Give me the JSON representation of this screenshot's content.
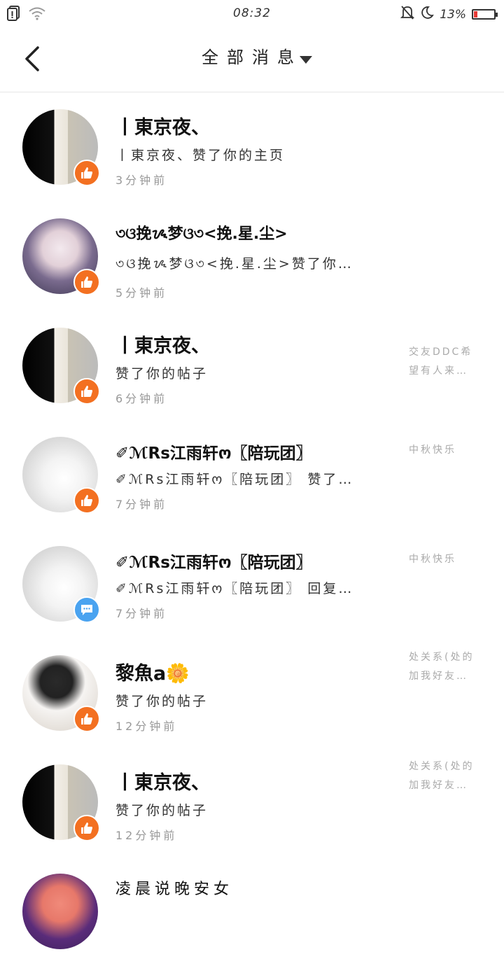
{
  "status_bar": {
    "time": "08:32",
    "battery": "13%",
    "battery_level": 0.13,
    "icons": [
      "notification-icon",
      "wifi-icon",
      "mute-bell-icon",
      "moon-icon",
      "battery-icon"
    ]
  },
  "header": {
    "title": "全部消息",
    "colors": {
      "divider": "#e6e6e6"
    }
  },
  "colors": {
    "like_badge": "#f37021",
    "comment_badge": "#4aa3f0"
  },
  "messages": [
    {
      "name": "丨東京夜、",
      "action": "丨東京夜、赞了你的主页",
      "time": "3分钟前",
      "badge": "like-icon",
      "preview": ""
    },
    {
      "name": "৩ଓ挽ᝰ梦ଓ৩<挽.星.尘>",
      "action": "৩ଓ挽ᝰ梦ଓ৩<挽.星.尘>赞了你…",
      "time": "5分钟前",
      "badge": "like-icon",
      "preview": ""
    },
    {
      "name": "丨東京夜、",
      "action": "赞了你的帖子",
      "time": "6分钟前",
      "badge": "like-icon",
      "preview": "交友DDC希望有人来…"
    },
    {
      "name": "✐ℳRs江雨轩ო〖陪玩团〗",
      "action": "✐ℳRs江雨轩ო〖陪玩团〗 赞了…",
      "time": "7分钟前",
      "badge": "like-icon",
      "preview": "中秋快乐"
    },
    {
      "name": "✐ℳRs江雨轩ო〖陪玩团〗",
      "action": "✐ℳRs江雨轩ო〖陪玩团〗 回复…",
      "time": "7分钟前",
      "badge": "comment-icon",
      "preview": "中秋快乐"
    },
    {
      "name": "黎魚a🌼",
      "action": "赞了你的帖子",
      "time": "12分钟前",
      "badge": "like-icon",
      "preview": "处关系(处的加我好友…"
    },
    {
      "name": "丨東京夜、",
      "action": "赞了你的帖子",
      "time": "12分钟前",
      "badge": "like-icon",
      "preview": "处关系(处的加我好友…"
    },
    {
      "name": "凌晨说晚安女",
      "action": "",
      "time": "",
      "badge": "",
      "preview": ""
    }
  ]
}
